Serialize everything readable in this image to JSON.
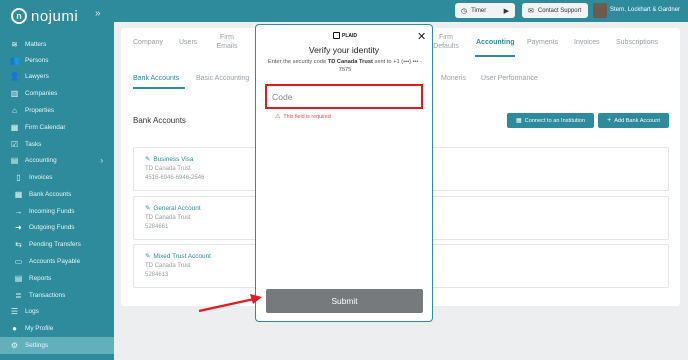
{
  "app": {
    "brand": "nojumi"
  },
  "topbar": {
    "timer_label": "Timer",
    "support_label": "Contact Support",
    "firm_name": "Stern, Lockhart & Gardner"
  },
  "sidebar": {
    "items": [
      {
        "label": "Matters",
        "icon": "layers-icon"
      },
      {
        "label": "Persons",
        "icon": "users-icon"
      },
      {
        "label": "Lawyers",
        "icon": "lawyer-icon"
      },
      {
        "label": "Companies",
        "icon": "building-icon"
      },
      {
        "label": "Properties",
        "icon": "house-icon"
      },
      {
        "label": "Firm Calendar",
        "icon": "calendar-icon"
      },
      {
        "label": "Tasks",
        "icon": "checkbox-icon"
      },
      {
        "label": "Accounting",
        "icon": "ledger-icon"
      },
      {
        "label": "Invoices",
        "icon": "invoice-icon"
      },
      {
        "label": "Bank Accounts",
        "icon": "bank-icon"
      },
      {
        "label": "Incoming Funds",
        "icon": "arrow-right-icon"
      },
      {
        "label": "Outgoing Funds",
        "icon": "arrow-right-circle-icon"
      },
      {
        "label": "Pending Transfers",
        "icon": "transfer-icon"
      },
      {
        "label": "Accounts Payable",
        "icon": "payable-icon"
      },
      {
        "label": "Reports",
        "icon": "report-icon"
      },
      {
        "label": "Transactions",
        "icon": "transactions-icon"
      },
      {
        "label": "Logs",
        "icon": "list-icon"
      },
      {
        "label": "My Profile",
        "icon": "profile-icon"
      },
      {
        "label": "Settings",
        "icon": "gear-icon"
      }
    ]
  },
  "tabs": [
    "Company",
    "Users",
    "Firm Emails",
    "Firm Defaults",
    "Accounting",
    "Payments",
    "Invoices",
    "Subscriptions"
  ],
  "sub_tabs": [
    "Bank Accounts",
    "Basic Accounting",
    "Moneris",
    "User Performance"
  ],
  "bank": {
    "title": "Bank Accounts",
    "connect_label": "Connect to an Institution",
    "add_label": "Add Bank Account",
    "accounts": [
      {
        "name": "Business Visa",
        "institution": "TD Canada Trust",
        "number": "4516-6946-6946-2546"
      },
      {
        "name": "General Account",
        "institution": "TD Canada Trust",
        "number": "5284661"
      },
      {
        "name": "Mixed Trust Account",
        "institution": "TD Canada Trust",
        "number": "5284613"
      }
    ]
  },
  "modal": {
    "brand": "PLAID",
    "title": "Verify your identity",
    "desc_prefix": "Enter the security code ",
    "desc_bank": "TD Canada Trust",
    "desc_suffix": " sent to +1 (•••) ••• - 7575",
    "code_placeholder": "Code",
    "error": "This field is required",
    "submit_label": "Submit"
  },
  "colors": {
    "accent": "#2d8b9c",
    "error": "#e11b22",
    "submit": "#777a7d",
    "arrow": "#e11b22"
  }
}
